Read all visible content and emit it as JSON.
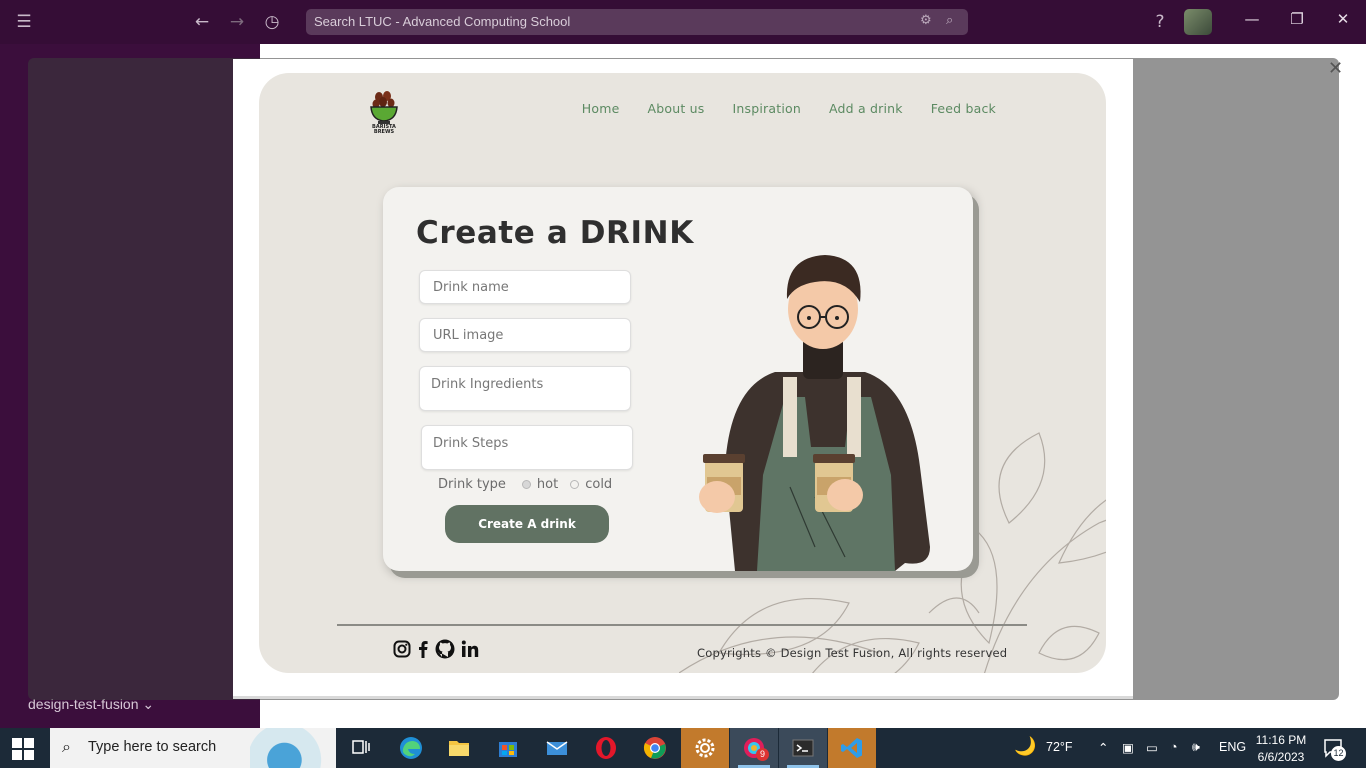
{
  "window": {
    "search_placeholder": "Search LTUC - Advanced Computing School",
    "workspace_name": "design-test-fusion"
  },
  "site": {
    "logo_text": "BARISTA BREWS",
    "nav": [
      "Home",
      "About us",
      "Inspiration",
      "Add a drink",
      "Feed back"
    ],
    "form": {
      "title": "Create a DRINK",
      "drink_name_placeholder": "Drink name",
      "url_image_placeholder": "URL image",
      "ingredients_placeholder": "Drink Ingredients",
      "steps_placeholder": "Drink Steps",
      "drink_type_label": "Drink type",
      "option_hot": "hot",
      "option_cold": "cold",
      "submit_label": "Create A drink"
    },
    "footer": {
      "social_icons": [
        "instagram-icon",
        "facebook-icon",
        "github-icon",
        "linkedin-icon"
      ],
      "copyright": "Copyrights © Design Test Fusion, All rights reserved"
    },
    "colors": {
      "nav_link": "#5c8a62",
      "button": "#617263",
      "page_bg": "#e8e5df"
    }
  },
  "taskbar": {
    "search_text": "Type here to search",
    "weather": "72°F",
    "language": "ENG",
    "time": "11:16 PM",
    "date": "6/6/2023",
    "notification_count": "12",
    "slack_badge": "9"
  }
}
